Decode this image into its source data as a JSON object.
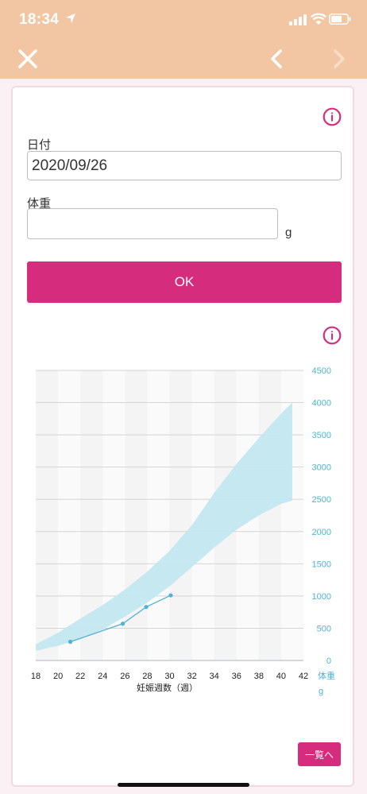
{
  "status_bar": {
    "time": "18:34",
    "icons": [
      "location-arrow-icon",
      "signal-icon",
      "wifi-icon",
      "battery-icon"
    ]
  },
  "nav": {
    "icons": [
      "close-icon",
      "chevron-left-icon",
      "chevron-right-icon"
    ]
  },
  "form": {
    "info_icon_glyph": "i",
    "date_label": "日付",
    "date_value": "2020/09/26",
    "weight_label": "体重",
    "weight_value": "",
    "weight_unit": "g",
    "ok_label": "OK"
  },
  "chart_info_icon_glyph": "i",
  "chart_data": {
    "type": "area",
    "xlabel": "妊娠週数（週）",
    "ylabel": "体重",
    "yunit": "g",
    "xlim": [
      18,
      42
    ],
    "ylim": [
      0,
      4500
    ],
    "x_ticks": [
      18,
      20,
      22,
      24,
      26,
      28,
      30,
      32,
      34,
      36,
      38,
      40,
      42
    ],
    "y_ticks": [
      0,
      500,
      1000,
      1500,
      2000,
      2500,
      3000,
      3500,
      4000,
      4500
    ],
    "grid": true,
    "band": {
      "x": [
        18,
        20,
        22,
        24,
        26,
        28,
        30,
        32,
        34,
        36,
        38,
        40,
        41
      ],
      "upper": [
        250,
        430,
        650,
        860,
        1100,
        1380,
        1700,
        2100,
        2600,
        3050,
        3450,
        3830,
        4000
      ],
      "lower": [
        150,
        230,
        330,
        480,
        680,
        900,
        1150,
        1450,
        1750,
        2030,
        2250,
        2430,
        2480
      ]
    },
    "series": [
      {
        "x": [
          21.1,
          25.8,
          27.9,
          30.1
        ],
        "values": [
          290,
          570,
          830,
          1010
        ]
      }
    ],
    "colors": {
      "band": "#c3e7ef",
      "line": "#4fb3d5",
      "stripe": "#f4f4f4",
      "axis_label": "#4fb3d5"
    }
  },
  "list_button_label": "一覧へ",
  "colors": {
    "accent": "#d62c7d",
    "topbar": "#f3c6a3",
    "background": "#fbf0f3"
  }
}
